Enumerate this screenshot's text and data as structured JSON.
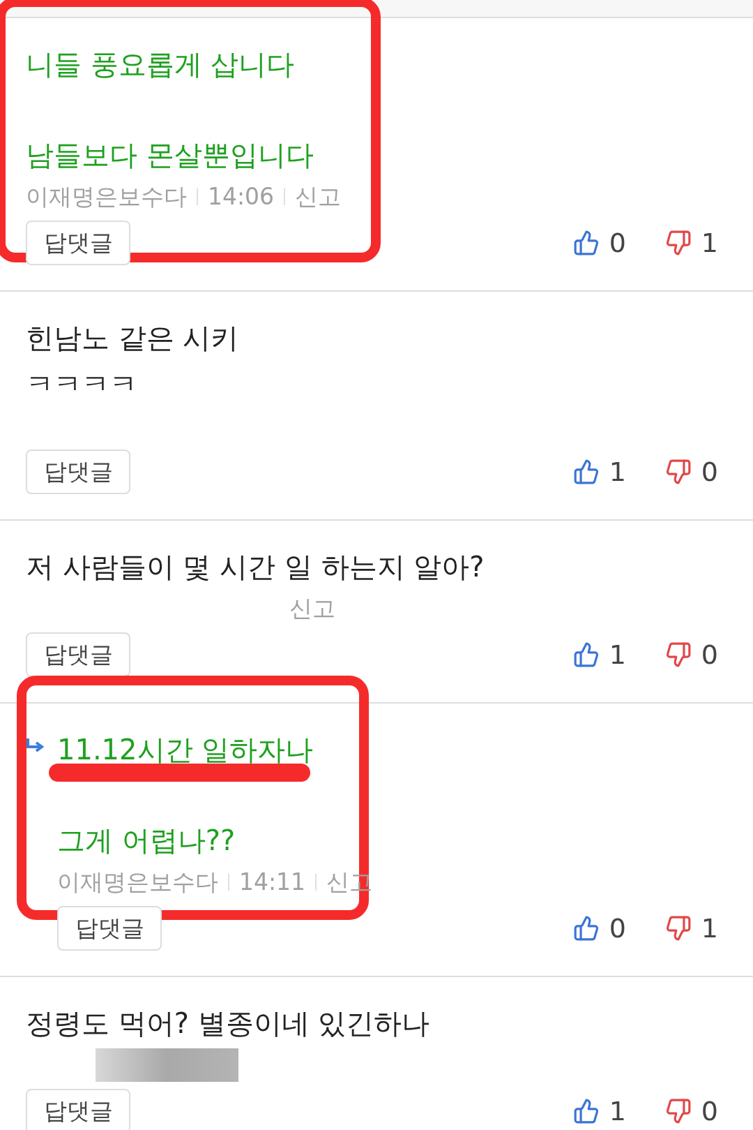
{
  "comments": [
    {
      "reply": false,
      "highlighted": true,
      "paragraphs": [
        [
          {
            "text": "니들 풍요롭게 삽니다",
            "underlined": false
          }
        ],
        [
          {
            "text": "남들보다 몬살뿐입니다",
            "underlined": false
          }
        ]
      ],
      "author": "이재명은보수다",
      "time": "14:06",
      "report": "신고",
      "reply_button": "답댓글",
      "likes": "0",
      "dislikes": "1",
      "redacted": false
    },
    {
      "reply": false,
      "highlighted": false,
      "paragraphs": [
        [
          {
            "text": "힌남노 같은 시키",
            "underlined": false
          },
          {
            "text": "ㅋㅋㅋㅋ",
            "underlined": false
          }
        ]
      ],
      "reply_button": "답댓글",
      "likes": "1",
      "dislikes": "0",
      "redacted": false
    },
    {
      "reply": false,
      "highlighted": false,
      "paragraphs": [
        [
          {
            "text": "저 사람들이 몇 시간 일 하는지 알아?",
            "underlined": false
          }
        ]
      ],
      "report": "신고",
      "reply_button": "답댓글",
      "likes": "1",
      "dislikes": "0",
      "redacted": false
    },
    {
      "reply": true,
      "highlighted": true,
      "paragraphs": [
        [
          {
            "text": "11.12시간 일하자나",
            "underlined": true
          }
        ],
        [
          {
            "text": "그게 어렵나??",
            "underlined": false
          }
        ]
      ],
      "author": "이재명은보수다",
      "time": "14:11",
      "report": "신고",
      "reply_button": "답댓글",
      "likes": "0",
      "dislikes": "1",
      "redacted": false
    },
    {
      "reply": false,
      "highlighted": false,
      "paragraphs": [
        [
          {
            "text": "정령도 먹어? 별종이네 있긴하나",
            "underlined": false
          }
        ]
      ],
      "reply_button": "답댓글",
      "likes": "1",
      "dislikes": "0",
      "redacted": true
    }
  ]
}
